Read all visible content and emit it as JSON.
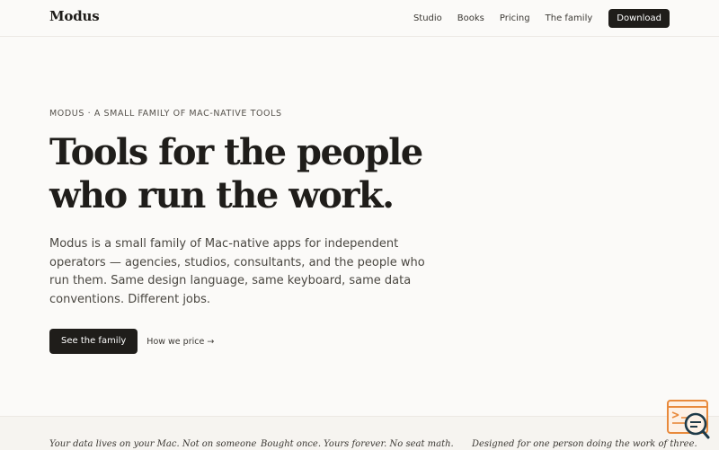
{
  "nav": {
    "logo": "Modus",
    "links": [
      "Studio",
      "Books",
      "Pricing",
      "The family"
    ],
    "cta": "Download"
  },
  "hero": {
    "eyebrow": "MODUS · A SMALL FAMILY OF MAC-NATIVE TOOLS",
    "headline_line1": "Tools for the people",
    "headline_line2": "who run the work.",
    "lede": "Modus is a small family of Mac-native apps for independent operators — agencies, studios, consultants, and the people who run them. Same design language, same keyboard, same data conventions. Different jobs.",
    "primary_cta": "See the family",
    "secondary_cta": "How we price →"
  },
  "strip": {
    "quotes": [
      "Your data lives on your Mac. Not on someone",
      "Bought once. Yours forever. No seat math.",
      "Designed for one person doing the work of three."
    ]
  },
  "widget": {
    "icon": "chat-search-icon",
    "accent": "#e88a3c"
  }
}
